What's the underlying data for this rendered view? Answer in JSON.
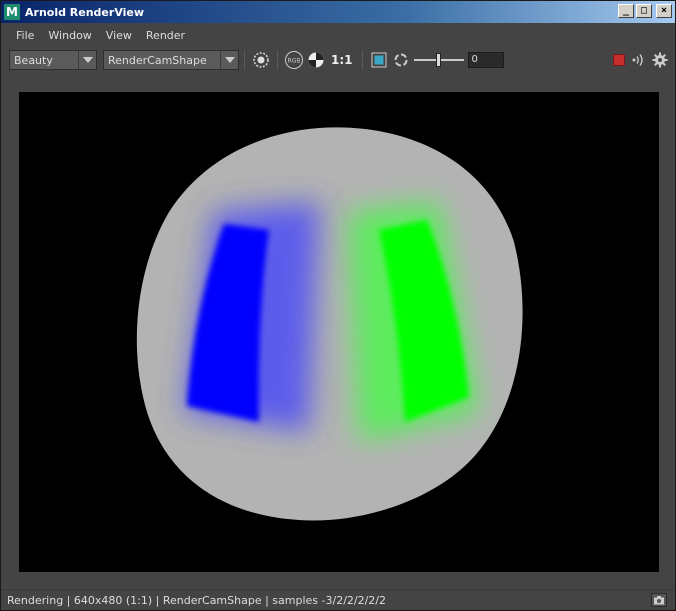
{
  "window": {
    "title": "Arnold RenderView",
    "app_icon_letter": "M",
    "buttons": {
      "minimize": "_",
      "maximize": "□",
      "close": "×"
    }
  },
  "menu": {
    "items": [
      {
        "label": "File"
      },
      {
        "label": "Window"
      },
      {
        "label": "View"
      },
      {
        "label": "Render"
      }
    ]
  },
  "toolbar": {
    "aov_value": "Beauty",
    "camera_value": "RenderCamShape",
    "rgb_label": "RGB",
    "ratio_label": "1:1",
    "exposure_value": "0",
    "exposure_level": 0.5,
    "icons": [
      "crosshair-icon",
      "rgb-icon",
      "checker-icon",
      "frame-icon",
      "refresh-icon",
      "stop-icon",
      "broadcast-icon",
      "gear-icon"
    ],
    "colors": {
      "stop": "#c42d2d"
    }
  },
  "viewport": {
    "colors": {
      "background": "#000000",
      "sphere": "#b3b3b3",
      "blue_patch": "#0000ff",
      "green_patch": "#00ff00"
    }
  },
  "status": {
    "text": "Rendering | 640x480 (1:1) | RenderCamShape  | samples -3/2/2/2/2/2"
  }
}
